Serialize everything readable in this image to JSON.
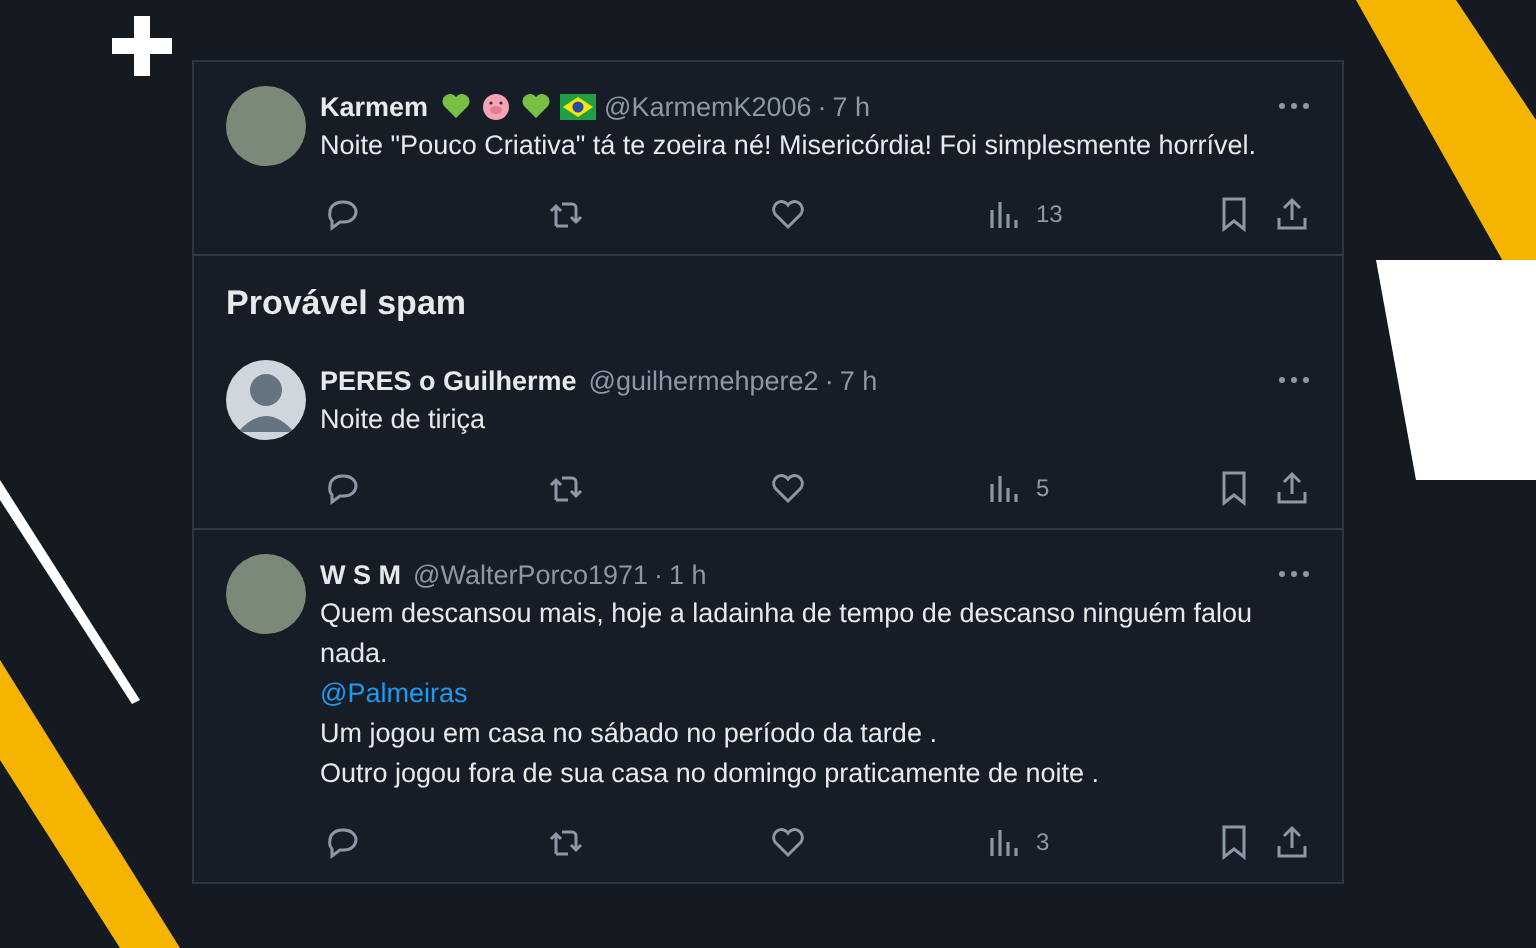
{
  "top_tweet": {
    "avatar": {
      "kind": "photo"
    },
    "name": "Karmem",
    "badges": [
      {
        "kind": "heart"
      },
      {
        "kind": "pig"
      },
      {
        "kind": "heart"
      },
      {
        "kind": "flag"
      }
    ],
    "handle": "@KarmemK2006",
    "separator": "·",
    "time": "7 h",
    "lines": [
      {
        "kind": "text",
        "text": "Noite \"Pouco Criativa\" tá te zoeira né! Misericórdia! Foi simplesmente horrível."
      }
    ],
    "views": "13"
  },
  "spam_section": {
    "title": "Provável spam",
    "tweets": [
      {
        "avatar": {
          "kind": "default"
        },
        "name": "PERES o Guilherme",
        "handle": "@guilhermehpere2",
        "separator": "·",
        "time": "7 h",
        "lines": [
          {
            "kind": "text",
            "text": "Noite de tiriça"
          }
        ],
        "views": "5"
      },
      {
        "avatar": {
          "kind": "photo"
        },
        "name": "W S M",
        "handle": "@WalterPorco1971",
        "separator": "·",
        "time": "1 h",
        "lines": [
          {
            "kind": "text",
            "text": "Quem descansou mais, hoje a ladainha de tempo de descanso ninguém falou nada."
          },
          {
            "kind": "mention",
            "text": "@Palmeiras"
          },
          {
            "kind": "text",
            "text": "Um jogou em casa no sábado no período da tarde ."
          },
          {
            "kind": "text",
            "text": "Outro jogou fora de sua casa no domingo praticamente de noite ."
          }
        ],
        "views": "3"
      }
    ]
  }
}
